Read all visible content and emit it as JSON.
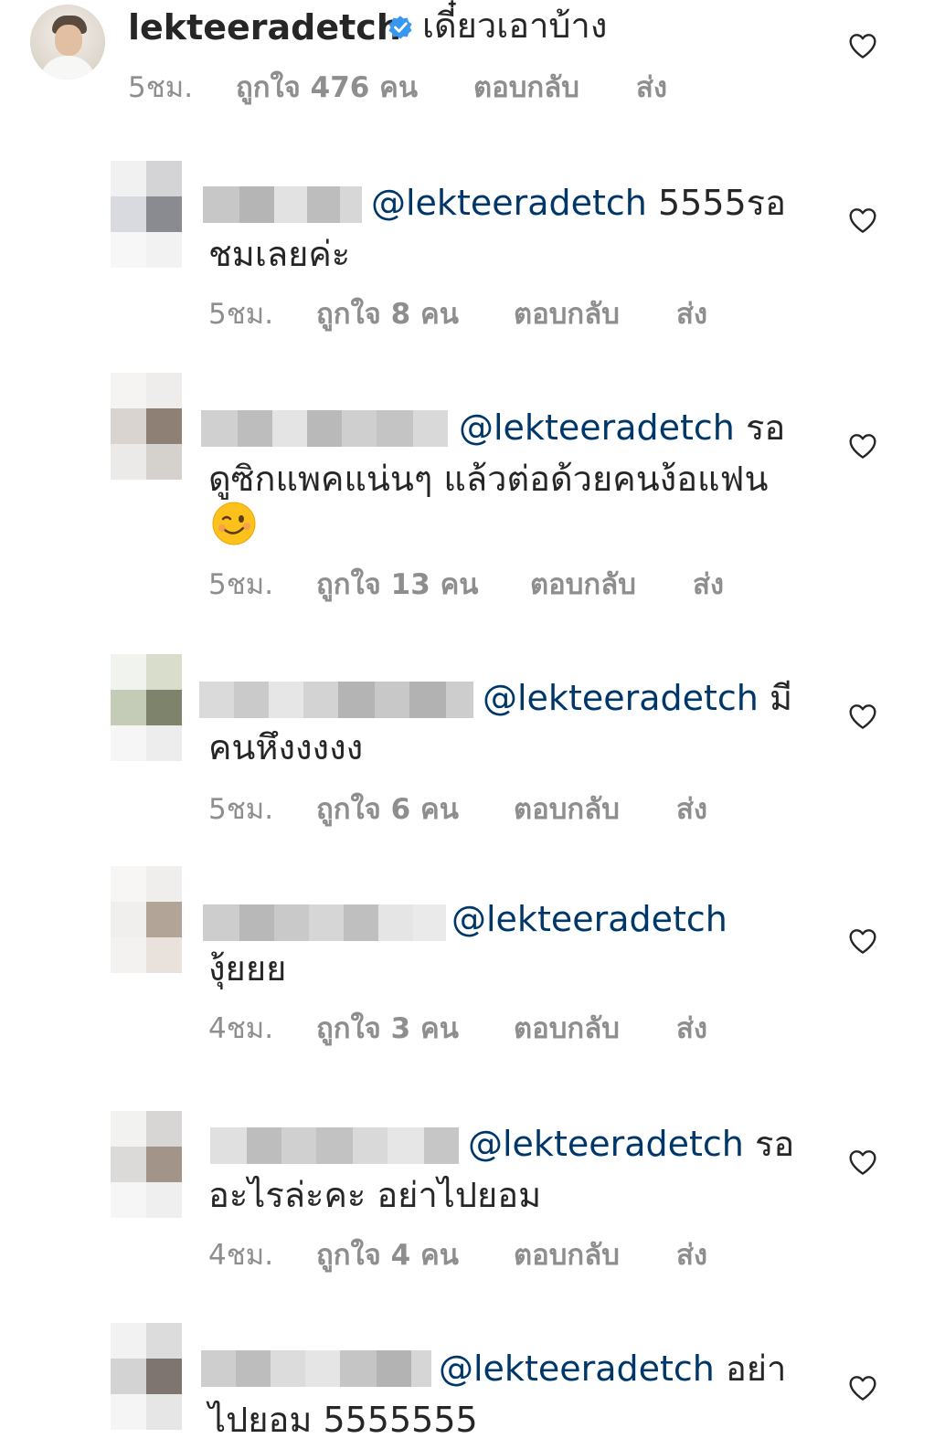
{
  "main_comment": {
    "username": "lekteeradetch",
    "text": "เดี๋ยวเอาบ้าง",
    "time": "5ชม.",
    "likes": "ถูกใจ 476 คน",
    "reply": "ตอบกลับ",
    "send": "ส่ง"
  },
  "replies": [
    {
      "mention": "@lekteeradetch",
      "line1_rest": " 5555รอ",
      "line2": "ชมเลยค่ะ",
      "time": "5ชม.",
      "likes": "ถูกใจ 8 คน",
      "reply": "ตอบกลับ",
      "send": "ส่ง"
    },
    {
      "mention": "@lekteeradetch",
      "line1_rest": " รอ",
      "line2": "ดูซิกแพคแน่นๆ แล้วต่อด้วยคนง้อแฟน",
      "emoji": "winking-face",
      "time": "5ชม.",
      "likes": "ถูกใจ 13 คน",
      "reply": "ตอบกลับ",
      "send": "ส่ง"
    },
    {
      "mention": "@lekteeradetch",
      "line1_rest": " มี",
      "line2": "คนหึงงงงง",
      "time": "5ชม.",
      "likes": "ถูกใจ 6 คน",
      "reply": "ตอบกลับ",
      "send": "ส่ง"
    },
    {
      "mention": "@lekteeradetch",
      "line1_rest": "",
      "line2": "งุ้ยยย",
      "time": "4ชม.",
      "likes": "ถูกใจ 3 คน",
      "reply": "ตอบกลับ",
      "send": "ส่ง"
    },
    {
      "mention": "@lekteeradetch",
      "line1_rest": " รอ",
      "line2": "อะไรล่ะคะ อย่าไปยอม",
      "time": "4ชม.",
      "likes": "ถูกใจ 4 คน",
      "reply": "ตอบกลับ",
      "send": "ส่ง"
    },
    {
      "mention": "@lekteeradetch",
      "line1_rest": " อย่า",
      "line2": "ไปยอม 5555555",
      "time": "",
      "likes": "",
      "reply": "",
      "send": ""
    }
  ],
  "colors": {
    "text": "#262626",
    "mention": "#00376b",
    "meta": "#8e8e8e",
    "verified": "#3897f0"
  },
  "icons": {
    "like": "heart-outline-icon",
    "verified": "verified-badge-icon"
  }
}
